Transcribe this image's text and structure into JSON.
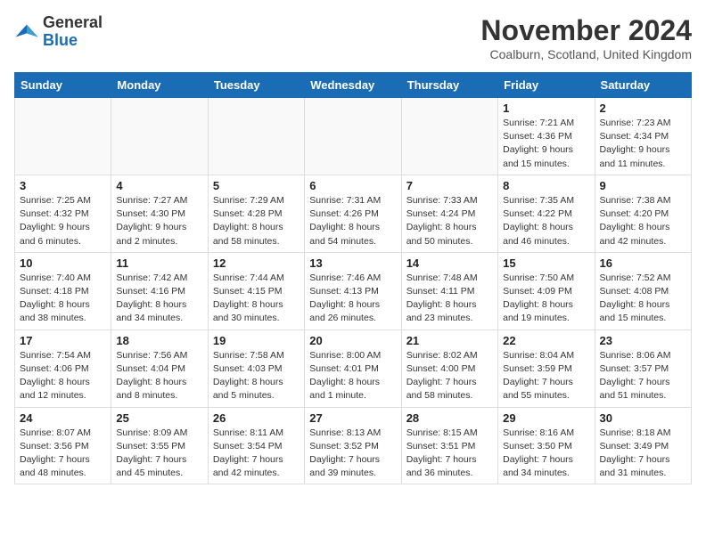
{
  "header": {
    "logo_general": "General",
    "logo_blue": "Blue",
    "month_title": "November 2024",
    "location": "Coalburn, Scotland, United Kingdom"
  },
  "weekdays": [
    "Sunday",
    "Monday",
    "Tuesday",
    "Wednesday",
    "Thursday",
    "Friday",
    "Saturday"
  ],
  "weeks": [
    [
      {
        "day": "",
        "info": ""
      },
      {
        "day": "",
        "info": ""
      },
      {
        "day": "",
        "info": ""
      },
      {
        "day": "",
        "info": ""
      },
      {
        "day": "",
        "info": ""
      },
      {
        "day": "1",
        "info": "Sunrise: 7:21 AM\nSunset: 4:36 PM\nDaylight: 9 hours\nand 15 minutes."
      },
      {
        "day": "2",
        "info": "Sunrise: 7:23 AM\nSunset: 4:34 PM\nDaylight: 9 hours\nand 11 minutes."
      }
    ],
    [
      {
        "day": "3",
        "info": "Sunrise: 7:25 AM\nSunset: 4:32 PM\nDaylight: 9 hours\nand 6 minutes."
      },
      {
        "day": "4",
        "info": "Sunrise: 7:27 AM\nSunset: 4:30 PM\nDaylight: 9 hours\nand 2 minutes."
      },
      {
        "day": "5",
        "info": "Sunrise: 7:29 AM\nSunset: 4:28 PM\nDaylight: 8 hours\nand 58 minutes."
      },
      {
        "day": "6",
        "info": "Sunrise: 7:31 AM\nSunset: 4:26 PM\nDaylight: 8 hours\nand 54 minutes."
      },
      {
        "day": "7",
        "info": "Sunrise: 7:33 AM\nSunset: 4:24 PM\nDaylight: 8 hours\nand 50 minutes."
      },
      {
        "day": "8",
        "info": "Sunrise: 7:35 AM\nSunset: 4:22 PM\nDaylight: 8 hours\nand 46 minutes."
      },
      {
        "day": "9",
        "info": "Sunrise: 7:38 AM\nSunset: 4:20 PM\nDaylight: 8 hours\nand 42 minutes."
      }
    ],
    [
      {
        "day": "10",
        "info": "Sunrise: 7:40 AM\nSunset: 4:18 PM\nDaylight: 8 hours\nand 38 minutes."
      },
      {
        "day": "11",
        "info": "Sunrise: 7:42 AM\nSunset: 4:16 PM\nDaylight: 8 hours\nand 34 minutes."
      },
      {
        "day": "12",
        "info": "Sunrise: 7:44 AM\nSunset: 4:15 PM\nDaylight: 8 hours\nand 30 minutes."
      },
      {
        "day": "13",
        "info": "Sunrise: 7:46 AM\nSunset: 4:13 PM\nDaylight: 8 hours\nand 26 minutes."
      },
      {
        "day": "14",
        "info": "Sunrise: 7:48 AM\nSunset: 4:11 PM\nDaylight: 8 hours\nand 23 minutes."
      },
      {
        "day": "15",
        "info": "Sunrise: 7:50 AM\nSunset: 4:09 PM\nDaylight: 8 hours\nand 19 minutes."
      },
      {
        "day": "16",
        "info": "Sunrise: 7:52 AM\nSunset: 4:08 PM\nDaylight: 8 hours\nand 15 minutes."
      }
    ],
    [
      {
        "day": "17",
        "info": "Sunrise: 7:54 AM\nSunset: 4:06 PM\nDaylight: 8 hours\nand 12 minutes."
      },
      {
        "day": "18",
        "info": "Sunrise: 7:56 AM\nSunset: 4:04 PM\nDaylight: 8 hours\nand 8 minutes."
      },
      {
        "day": "19",
        "info": "Sunrise: 7:58 AM\nSunset: 4:03 PM\nDaylight: 8 hours\nand 5 minutes."
      },
      {
        "day": "20",
        "info": "Sunrise: 8:00 AM\nSunset: 4:01 PM\nDaylight: 8 hours\nand 1 minute."
      },
      {
        "day": "21",
        "info": "Sunrise: 8:02 AM\nSunset: 4:00 PM\nDaylight: 7 hours\nand 58 minutes."
      },
      {
        "day": "22",
        "info": "Sunrise: 8:04 AM\nSunset: 3:59 PM\nDaylight: 7 hours\nand 55 minutes."
      },
      {
        "day": "23",
        "info": "Sunrise: 8:06 AM\nSunset: 3:57 PM\nDaylight: 7 hours\nand 51 minutes."
      }
    ],
    [
      {
        "day": "24",
        "info": "Sunrise: 8:07 AM\nSunset: 3:56 PM\nDaylight: 7 hours\nand 48 minutes."
      },
      {
        "day": "25",
        "info": "Sunrise: 8:09 AM\nSunset: 3:55 PM\nDaylight: 7 hours\nand 45 minutes."
      },
      {
        "day": "26",
        "info": "Sunrise: 8:11 AM\nSunset: 3:54 PM\nDaylight: 7 hours\nand 42 minutes."
      },
      {
        "day": "27",
        "info": "Sunrise: 8:13 AM\nSunset: 3:52 PM\nDaylight: 7 hours\nand 39 minutes."
      },
      {
        "day": "28",
        "info": "Sunrise: 8:15 AM\nSunset: 3:51 PM\nDaylight: 7 hours\nand 36 minutes."
      },
      {
        "day": "29",
        "info": "Sunrise: 8:16 AM\nSunset: 3:50 PM\nDaylight: 7 hours\nand 34 minutes."
      },
      {
        "day": "30",
        "info": "Sunrise: 8:18 AM\nSunset: 3:49 PM\nDaylight: 7 hours\nand 31 minutes."
      }
    ]
  ]
}
